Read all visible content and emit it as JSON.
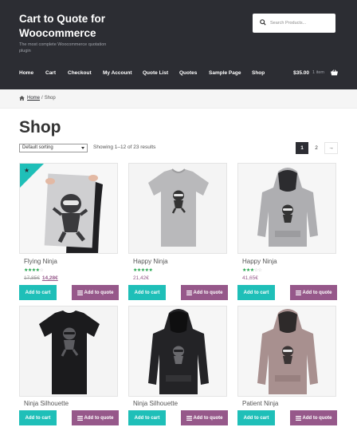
{
  "header": {
    "site_title": "Cart to Quote for Woocommerce",
    "tagline": "The most complete Woocommerce quotation plugin",
    "search_placeholder": "Search Products...",
    "nav": [
      "Home",
      "Cart",
      "Checkout",
      "My Account",
      "Quote List",
      "Quotes",
      "Sample Page",
      "Shop"
    ],
    "cart_total": "$35.00",
    "cart_count": "1 item"
  },
  "breadcrumb": {
    "home": "Home",
    "sep": "/",
    "current": "Shop"
  },
  "page_title": "Shop",
  "toolbar": {
    "sort_value": "Default sorting",
    "result_count": "Showing 1–12 of 23 results",
    "pages": [
      "1",
      "2"
    ],
    "next": "→"
  },
  "buttons": {
    "add_to_cart": "Add to cart",
    "add_to_quote": "Add to quote"
  },
  "colors": {
    "header_bg": "#2c2d33",
    "cart_button": "#1fbfb8",
    "quote_button": "#96588a",
    "star_rating": "#1fa34a"
  },
  "products": [
    {
      "name": "Flying Ninja",
      "rating": 4,
      "price_old": "17,85€",
      "price_new": "14,28€",
      "on_sale": true,
      "image": "poster-ninja"
    },
    {
      "name": "Happy Ninja",
      "rating": 5,
      "price": "21,42€",
      "image": "grey-tshirt"
    },
    {
      "name": "Happy Ninja",
      "rating": 3,
      "price": "41,65€",
      "image": "grey-hoodie"
    },
    {
      "name": "Ninja Silhouette",
      "image": "black-tshirt"
    },
    {
      "name": "Ninja Silhouette",
      "image": "black-hoodie"
    },
    {
      "name": "Patient Ninja",
      "image": "pink-hoodie"
    }
  ]
}
